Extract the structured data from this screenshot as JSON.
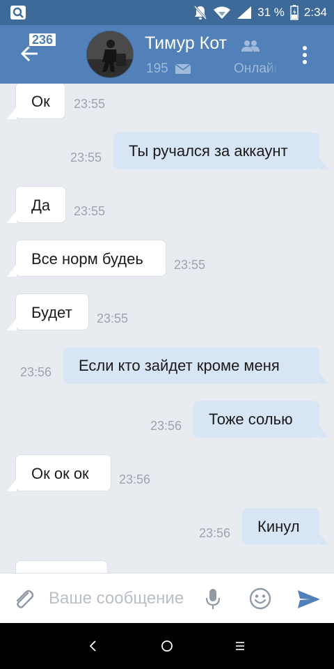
{
  "status_bar": {
    "battery": "31 %",
    "time": "2:34"
  },
  "header": {
    "unread_badge": "236",
    "contact_name": "Тимур Кот",
    "message_count": "195",
    "online_status": "Онлайн"
  },
  "messages": [
    {
      "text": "Ок",
      "time": "23:55",
      "direction": "in"
    },
    {
      "text": "Ты ручался за аккаунт",
      "time": "23:55",
      "direction": "out"
    },
    {
      "text": "Да",
      "time": "23:55",
      "direction": "in"
    },
    {
      "text": "Все норм будеь",
      "time": "23:55",
      "direction": "in"
    },
    {
      "text": "Будет",
      "time": "23:55",
      "direction": "in"
    },
    {
      "text": "Если кто зайдет кроме меня",
      "time": "23:56",
      "direction": "out"
    },
    {
      "text": "Тоже солью",
      "time": "23:56",
      "direction": "out"
    },
    {
      "text": "Ок ок ок",
      "time": "23:56",
      "direction": "in"
    },
    {
      "text": "Кинул",
      "time": "23:56",
      "direction": "out"
    }
  ],
  "composer": {
    "placeholder": "Ваше сообщение",
    "value": ""
  },
  "colors": {
    "header": "#5181b8",
    "status_bar": "#3e6a99",
    "background": "#e8ecf1",
    "incoming_bubble": "#ffffff",
    "outgoing_bubble": "#d7e5f5",
    "send_accent": "#5181b8"
  },
  "icons": {
    "status_left": "search-icon",
    "back": "back-arrow-icon",
    "friends": "friends-icon",
    "envelope": "envelope-icon",
    "more": "more-vertical-icon",
    "attach": "paperclip-icon",
    "mic": "microphone-icon",
    "emoji": "emoji-icon",
    "send": "send-icon"
  }
}
